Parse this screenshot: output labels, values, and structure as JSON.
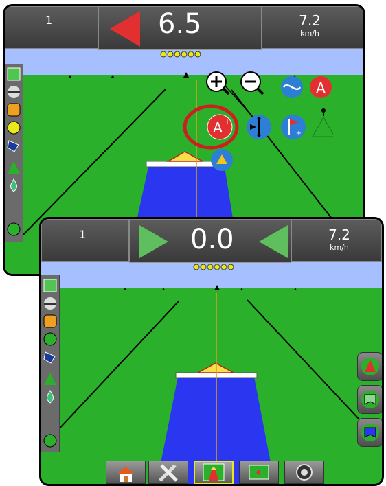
{
  "colors": {
    "sky": "#a6bfff",
    "grass": "#2bb02b",
    "spray_area": "#2a36f0",
    "boom": "#ffffff",
    "boom_center": "#f5e04a",
    "arrow_left_red": "#e23030",
    "arrow_green": "#5fbf5f",
    "highlight_ring": "#cc1f1f",
    "panel_gray": "#6b6b6b",
    "led_yellow": "#e8e81a"
  },
  "back_screen": {
    "topbar": {
      "swath_number": "1",
      "cross_track_value": "6.5",
      "speed_value": "7.2",
      "speed_unit": "km/h",
      "guidance_arrow": "left-red-arrow"
    },
    "toolbar_icons": [
      "zoom-in-icon",
      "zoom-out-icon",
      "guidance-mode-icon",
      "mark-a-icon",
      "a-plus-nudge-icon",
      "align-icon",
      "add-marker-flag-icon",
      "vehicle-view-icon",
      "guidance-arrow-icon"
    ],
    "highlighted_button": "a-plus-nudge-button"
  },
  "front_screen": {
    "topbar": {
      "swath_number": "1",
      "cross_track_value": "0.0",
      "speed_value": "7.2",
      "speed_unit": "km/h",
      "guidance_arrows": [
        "right-green-arrow",
        "left-green-arrow"
      ]
    },
    "right_buttons": [
      "guidance-arrow-icon",
      "boundary-outside-icon",
      "boundary-inside-icon"
    ],
    "bottom_tabs": [
      "home-icon",
      "tools-icon",
      "guidance-view-icon",
      "field-view-icon",
      "screen-settings-icon"
    ],
    "active_tab": "guidance-view-icon"
  },
  "left_panel_icons": [
    "section-status-icon",
    "boom-icon",
    "steering-icon",
    "tilt-icon",
    "gps-icon",
    "vehicle-icon",
    "application-rate-icon",
    "settings-link-icon"
  ]
}
